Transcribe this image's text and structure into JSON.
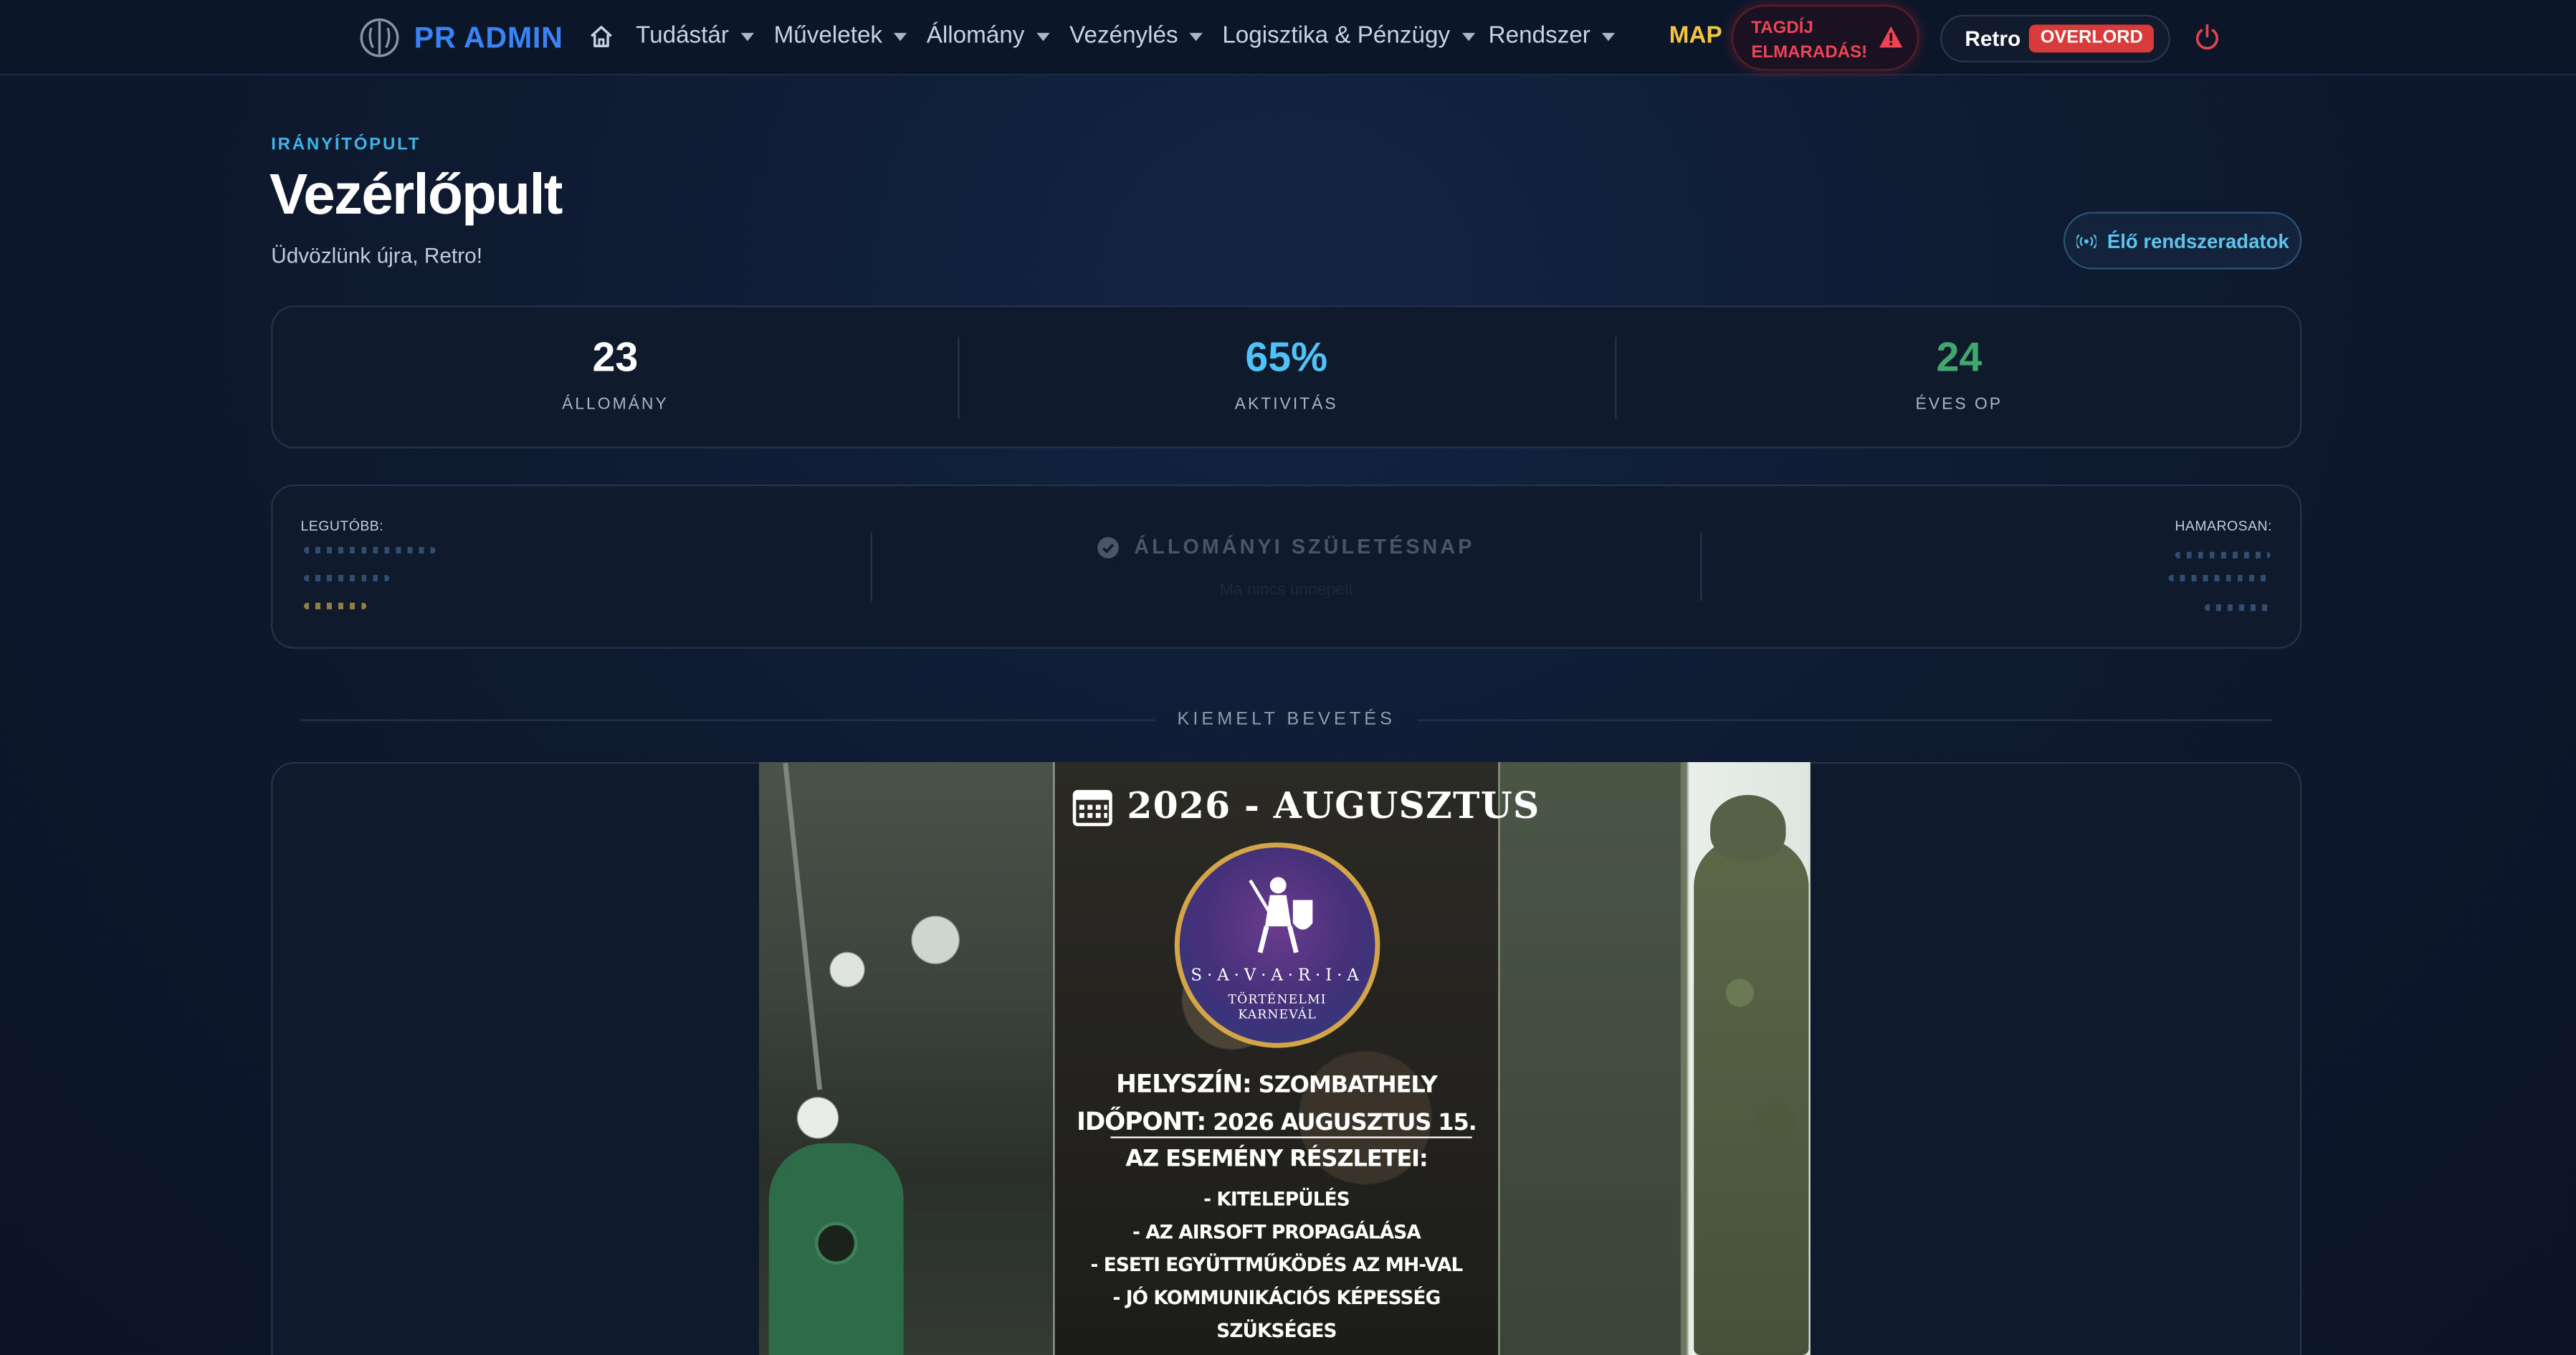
{
  "nav": {
    "brand": "PR ADMIN",
    "items": [
      {
        "label": "Tudástár"
      },
      {
        "label": "Műveletek"
      },
      {
        "label": "Állomány"
      },
      {
        "label": "Vezénylés"
      },
      {
        "label": "Logisztika & Pénzügy"
      },
      {
        "label": "Rendszer"
      }
    ],
    "map": "MAP",
    "alert": {
      "line1": "TAGDÍJ",
      "line2": "ELMARADÁS!"
    },
    "user": {
      "name": "Retro",
      "rank": "OVERLORD"
    },
    "colors": {
      "brand": "#3b82f6",
      "map": "#f5c542",
      "alert": "#ef4456",
      "rank": "#d93a3a"
    }
  },
  "header": {
    "eyebrow": "IRÁNYÍTÓPULT",
    "title": "Vezérlőpult",
    "welcome": "Üdvözlünk újra, Retro!",
    "live_button": "Élő rendszeradatok"
  },
  "stats": [
    {
      "value": "23",
      "label": "ÁLLOMÁNY",
      "color": "#ffffff"
    },
    {
      "value": "65%",
      "label": "AKTIVITÁS",
      "color": "#4fc3f7"
    },
    {
      "value": "24",
      "label": "ÉVES OP",
      "color": "#3fa86b"
    }
  ],
  "birthday": {
    "recent_label": "LEGUTÓBB:",
    "title": "ÁLLOMÁNYI SZÜLETÉSNAP",
    "subtitle": "Ma nincs ünnepelt",
    "upcoming_label": "HAMAROSAN:"
  },
  "featured": {
    "section_title": "KIEMELT BEVETÉS",
    "poster": {
      "date": "2026 - AUGUSZTUS",
      "logo_title": "S·A·V·A·R·I·A",
      "logo_sub_1": "TÖRTÉNELMI",
      "logo_sub_2": "KARNEVÁL",
      "location_label": "HELYSZÍN:",
      "location": "SZOMBATHELY",
      "date_label": "IDŐPONT:",
      "date_value": "2026 AUGUSZTUS 15.",
      "details_heading": "AZ ESEMÉNY RÉSZLETEI:",
      "details": [
        "- KITELEPÜLÉS",
        "- AZ AIRSOFT PROPAGÁLÁSA",
        "- ESETI EGYÜTTMŰKÖDÉS AZ MH-VAL",
        "- JÓ KOMMUNIKÁCIÓS KÉPESSÉG SZÜKSÉGES"
      ]
    }
  }
}
